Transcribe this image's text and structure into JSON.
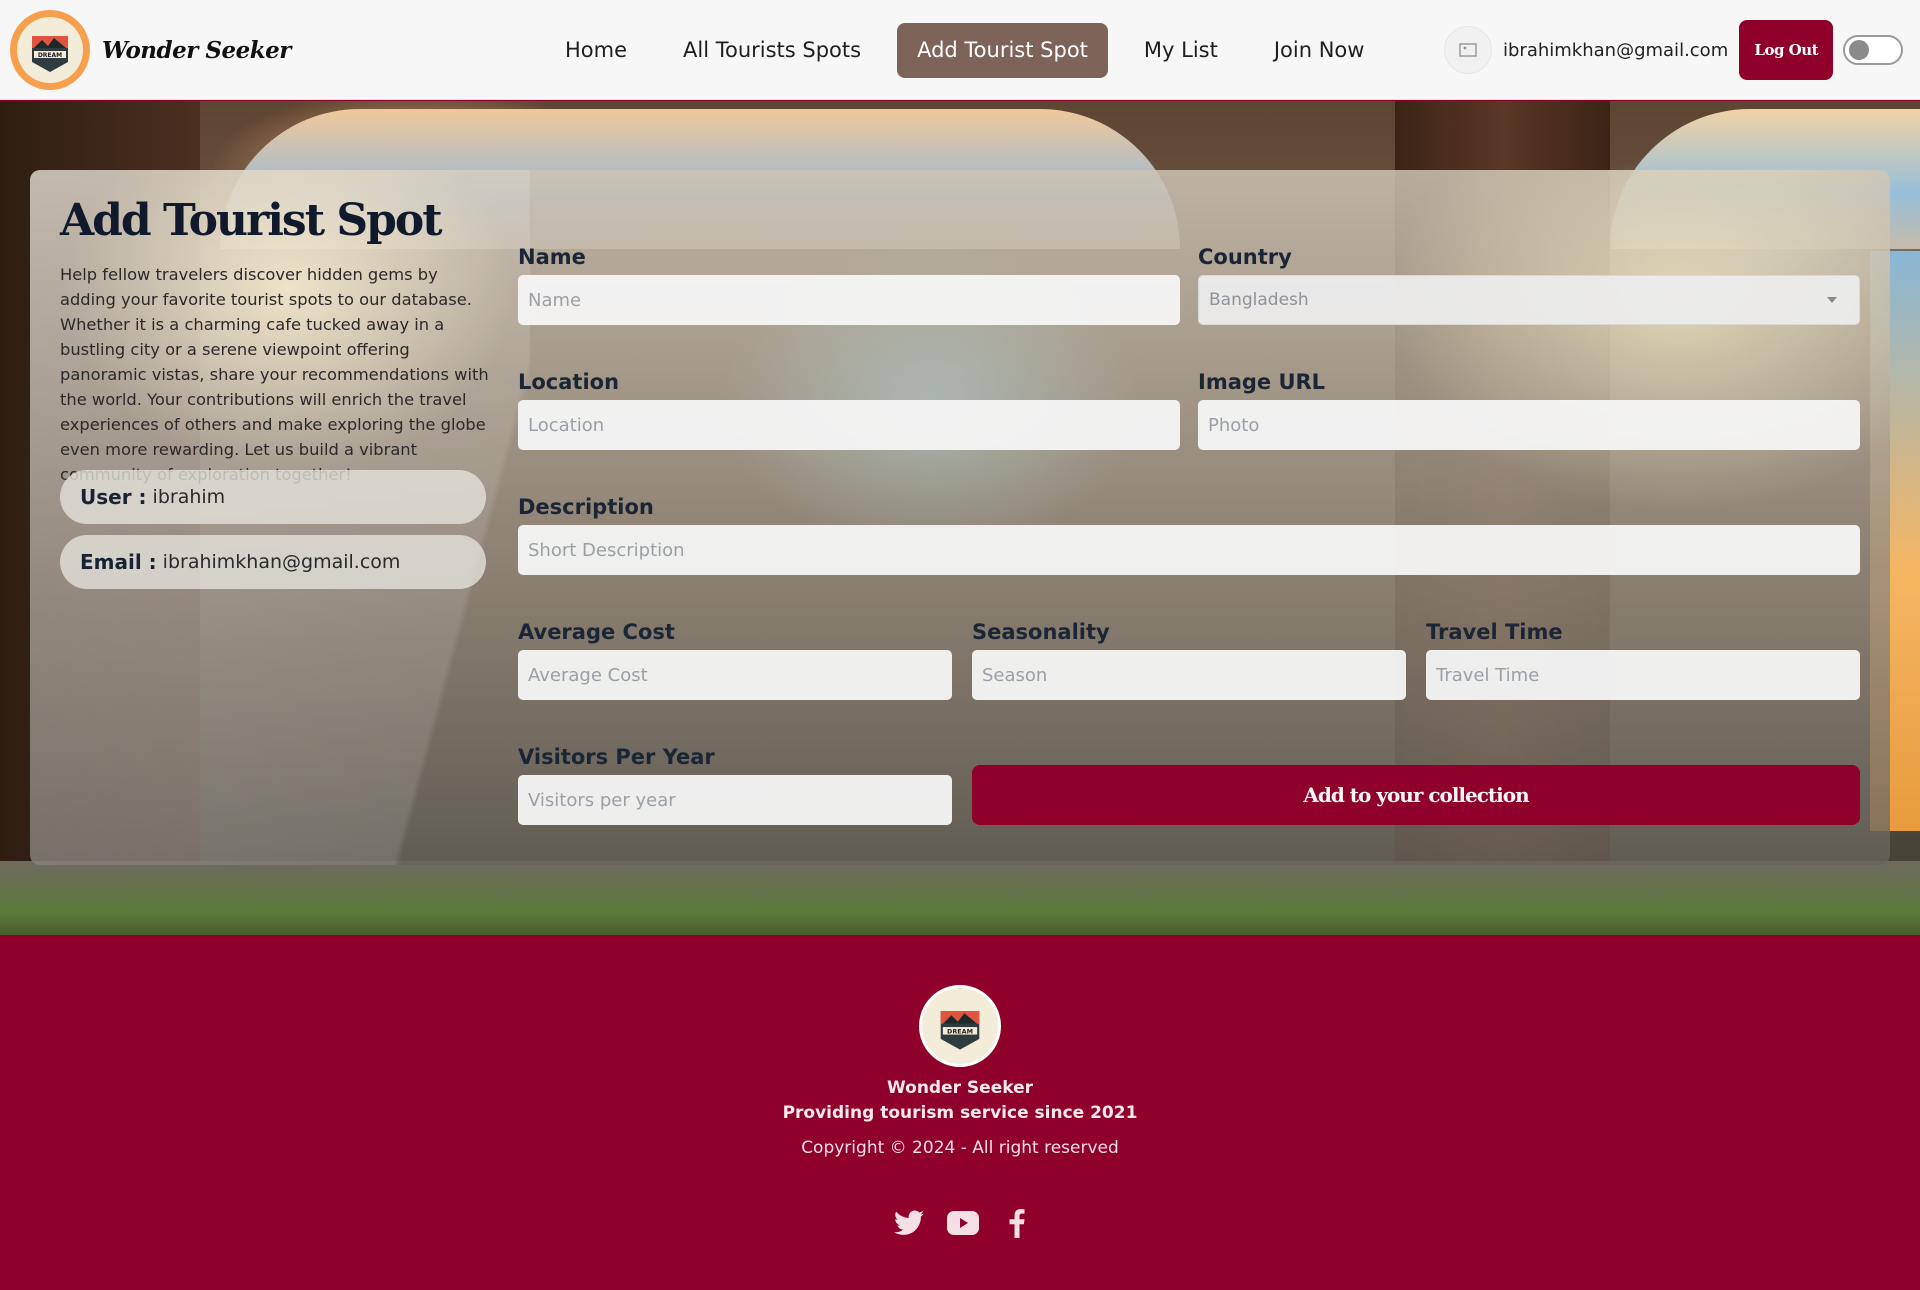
{
  "brand": {
    "name": "Wonder Seeker",
    "logo_text": "DREAM",
    "logo_icon": "mountain-badge-icon"
  },
  "nav": {
    "links": [
      {
        "label": "Home",
        "active": false
      },
      {
        "label": "All Tourists Spots",
        "active": false
      },
      {
        "label": "Add Tourist Spot",
        "active": true
      },
      {
        "label": "My List",
        "active": false
      },
      {
        "label": "Join Now",
        "active": false
      }
    ],
    "user_email": "ibrahimkhan@gmail.com",
    "logout_label": "Log Out",
    "theme_toggle": "off"
  },
  "form": {
    "title": "Add Tourist Spot",
    "description": "Help fellow travelers discover hidden gems by adding your favorite tourist spots to our database. Whether it is a charming cafe tucked away in a bustling city or a serene viewpoint offering panoramic vistas, share your recommendations with the world. Your contributions will enrich the travel experiences of others and make exploring the globe even more rewarding. Let us build a vibrant community of exploration together!",
    "user_label": "User :",
    "user_value": "ibrahim",
    "email_label": "Email :",
    "email_value": "ibrahimkhan@gmail.com",
    "fields": {
      "name": {
        "label": "Name",
        "placeholder": "Name",
        "value": ""
      },
      "country": {
        "label": "Country",
        "selected": "Bangladesh"
      },
      "location": {
        "label": "Location",
        "placeholder": "Location",
        "value": ""
      },
      "image_url": {
        "label": "Image URL",
        "placeholder": "Photo",
        "value": ""
      },
      "description": {
        "label": "Description",
        "placeholder": "Short Description",
        "value": ""
      },
      "average_cost": {
        "label": "Average Cost",
        "placeholder": "Average Cost",
        "value": ""
      },
      "seasonality": {
        "label": "Seasonality",
        "placeholder": "Season",
        "value": ""
      },
      "travel_time": {
        "label": "Travel Time",
        "placeholder": "Travel Time",
        "value": ""
      },
      "visitors": {
        "label": "Visitors Per Year",
        "placeholder": "Visitors per year",
        "value": ""
      }
    },
    "submit_label": "Add to your collection"
  },
  "footer": {
    "name": "Wonder Seeker",
    "tagline": "Providing tourism service since 2021",
    "copyright": "Copyright © 2024 - All right reserved",
    "socials": [
      "twitter-icon",
      "youtube-icon",
      "facebook-icon"
    ]
  },
  "colors": {
    "brand": "#8f002b",
    "active_nav": "#7e6359",
    "logo_ring": "#f6a04d"
  }
}
